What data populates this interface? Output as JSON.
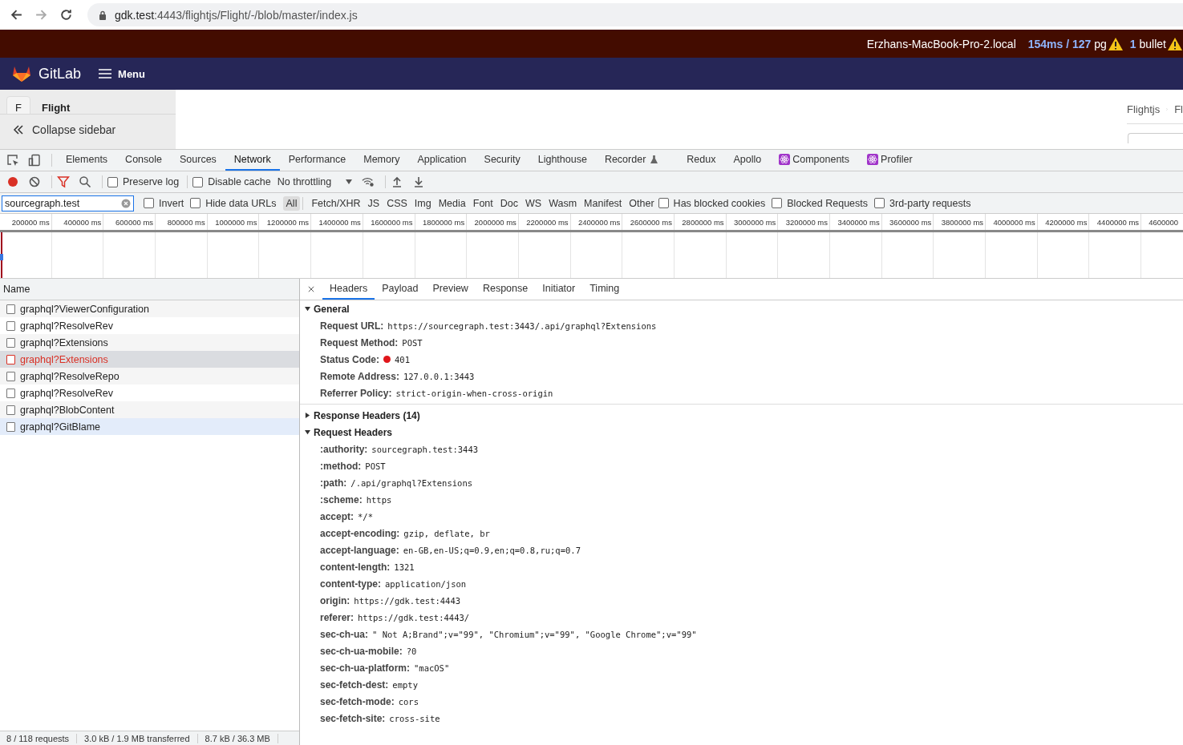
{
  "browser": {
    "url_host": "gdk.test",
    "url_path": ":4443/flightjs/Flight/-/blob/master/index.js"
  },
  "perf_bar": {
    "host": "Erzhans-MacBook-Pro-2.local",
    "timing": "154ms / 127",
    "timing_unit": "pg",
    "bullet_count": "1",
    "bullet_label": "bullet"
  },
  "gitlab_nav": {
    "brand": "GitLab",
    "menu": "Menu"
  },
  "sidebar": {
    "project_initial": "F",
    "project_name": "Flight",
    "collapse": "Collapse sidebar"
  },
  "breadcrumb": [
    "Flightjs",
    "Fl"
  ],
  "devtools_tabs": [
    {
      "label": "Elements",
      "selected": false,
      "kind": "plain"
    },
    {
      "label": "Console",
      "selected": false,
      "kind": "plain"
    },
    {
      "label": "Sources",
      "selected": false,
      "kind": "plain"
    },
    {
      "label": "Network",
      "selected": true,
      "kind": "plain"
    },
    {
      "label": "Performance",
      "selected": false,
      "kind": "plain"
    },
    {
      "label": "Memory",
      "selected": false,
      "kind": "plain"
    },
    {
      "label": "Application",
      "selected": false,
      "kind": "plain"
    },
    {
      "label": "Security",
      "selected": false,
      "kind": "plain"
    },
    {
      "label": "Lighthouse",
      "selected": false,
      "kind": "plain"
    },
    {
      "label": "Recorder",
      "selected": false,
      "kind": "experimental"
    },
    {
      "label": "Redux",
      "selected": false,
      "kind": "plain"
    },
    {
      "label": "Apollo",
      "selected": false,
      "kind": "plain"
    },
    {
      "label": "Components",
      "selected": false,
      "kind": "react"
    },
    {
      "label": "Profiler",
      "selected": false,
      "kind": "react"
    }
  ],
  "toolbar": {
    "recording": true,
    "preserve_log": {
      "label": "Preserve log",
      "checked": false
    },
    "disable_cache": {
      "label": "Disable cache",
      "checked": false
    },
    "throttling": "No throttling"
  },
  "filter": {
    "value": "sourcegraph.test",
    "options": [
      {
        "label": "Invert",
        "checked": false
      },
      {
        "label": "Hide data URLs",
        "checked": false
      }
    ],
    "types": [
      {
        "label": "All",
        "selected": true
      },
      {
        "label": "Fetch/XHR",
        "selected": false
      },
      {
        "label": "JS",
        "selected": false
      },
      {
        "label": "CSS",
        "selected": false
      },
      {
        "label": "Img",
        "selected": false
      },
      {
        "label": "Media",
        "selected": false
      },
      {
        "label": "Font",
        "selected": false
      },
      {
        "label": "Doc",
        "selected": false
      },
      {
        "label": "WS",
        "selected": false
      },
      {
        "label": "Wasm",
        "selected": false
      },
      {
        "label": "Manifest",
        "selected": false
      },
      {
        "label": "Other",
        "selected": false
      }
    ],
    "extra_options": [
      {
        "label": "Has blocked cookies",
        "checked": false
      },
      {
        "label": "Blocked Requests",
        "checked": false
      },
      {
        "label": "3rd-party requests",
        "checked": false
      }
    ]
  },
  "timeline_ticks": [
    "200000 ms",
    "400000 ms",
    "600000 ms",
    "800000 ms",
    "1000000 ms",
    "1200000 ms",
    "1400000 ms",
    "1600000 ms",
    "1800000 ms",
    "2000000 ms",
    "2200000 ms",
    "2400000 ms",
    "2600000 ms",
    "2800000 ms",
    "3000000 ms",
    "3200000 ms",
    "3400000 ms",
    "3600000 ms",
    "3800000 ms",
    "4000000 ms",
    "4200000 ms",
    "4400000 ms",
    "4600000"
  ],
  "requests_column": "Name",
  "requests": [
    {
      "name": "graphql?ViewerConfiguration",
      "selected": false,
      "error": false,
      "hovered": false
    },
    {
      "name": "graphql?ResolveRev",
      "selected": false,
      "error": false,
      "hovered": false
    },
    {
      "name": "graphql?Extensions",
      "selected": false,
      "error": false,
      "hovered": false
    },
    {
      "name": "graphql?Extensions",
      "selected": true,
      "error": true,
      "hovered": false
    },
    {
      "name": "graphql?ResolveRepo",
      "selected": false,
      "error": false,
      "hovered": false
    },
    {
      "name": "graphql?ResolveRev",
      "selected": false,
      "error": false,
      "hovered": false
    },
    {
      "name": "graphql?BlobContent",
      "selected": false,
      "error": false,
      "hovered": false
    },
    {
      "name": "graphql?GitBlame",
      "selected": false,
      "error": false,
      "hovered": true
    }
  ],
  "detail_tabs": [
    {
      "label": "Headers",
      "selected": true
    },
    {
      "label": "Payload",
      "selected": false
    },
    {
      "label": "Preview",
      "selected": false
    },
    {
      "label": "Response",
      "selected": false
    },
    {
      "label": "Initiator",
      "selected": false
    },
    {
      "label": "Timing",
      "selected": false
    }
  ],
  "sections": [
    {
      "title": "General",
      "expanded": true,
      "rows": [
        {
          "key": "Request URL:",
          "value": "https://sourcegraph.test:3443/.api/graphql?Extensions",
          "kind": "text"
        },
        {
          "key": "Request Method:",
          "value": "POST",
          "kind": "text"
        },
        {
          "key": "Status Code:",
          "value": "401",
          "kind": "status"
        },
        {
          "key": "Remote Address:",
          "value": "127.0.0.1:3443",
          "kind": "text"
        },
        {
          "key": "Referrer Policy:",
          "value": "strict-origin-when-cross-origin",
          "kind": "text"
        }
      ]
    },
    {
      "title": "Response Headers (14)",
      "expanded": false
    },
    {
      "title": "Request Headers",
      "expanded": true,
      "rows": [
        {
          "key": ":authority:",
          "value": "sourcegraph.test:3443",
          "kind": "text"
        },
        {
          "key": ":method:",
          "value": "POST",
          "kind": "text"
        },
        {
          "key": ":path:",
          "value": "/.api/graphql?Extensions",
          "kind": "text"
        },
        {
          "key": ":scheme:",
          "value": "https",
          "kind": "text"
        },
        {
          "key": "accept:",
          "value": "*/*",
          "kind": "text"
        },
        {
          "key": "accept-encoding:",
          "value": "gzip, deflate, br",
          "kind": "text"
        },
        {
          "key": "accept-language:",
          "value": "en-GB,en-US;q=0.9,en;q=0.8,ru;q=0.7",
          "kind": "text"
        },
        {
          "key": "content-length:",
          "value": "1321",
          "kind": "text"
        },
        {
          "key": "content-type:",
          "value": "application/json",
          "kind": "text"
        },
        {
          "key": "origin:",
          "value": "https://gdk.test:4443",
          "kind": "text"
        },
        {
          "key": "referer:",
          "value": "https://gdk.test:4443/",
          "kind": "text"
        },
        {
          "key": "sec-ch-ua:",
          "value": "\" Not A;Brand\";v=\"99\", \"Chromium\";v=\"99\", \"Google Chrome\";v=\"99\"",
          "kind": "text"
        },
        {
          "key": "sec-ch-ua-mobile:",
          "value": "?0",
          "kind": "text"
        },
        {
          "key": "sec-ch-ua-platform:",
          "value": "\"macOS\"",
          "kind": "text"
        },
        {
          "key": "sec-fetch-dest:",
          "value": "empty",
          "kind": "text"
        },
        {
          "key": "sec-fetch-mode:",
          "value": "cors",
          "kind": "text"
        },
        {
          "key": "sec-fetch-site:",
          "value": "cross-site",
          "kind": "text"
        }
      ]
    }
  ],
  "status_bar": [
    "8 / 118 requests",
    "3.0 kB / 1.9 MB transferred",
    "8.7 kB / 36.3 MB"
  ]
}
